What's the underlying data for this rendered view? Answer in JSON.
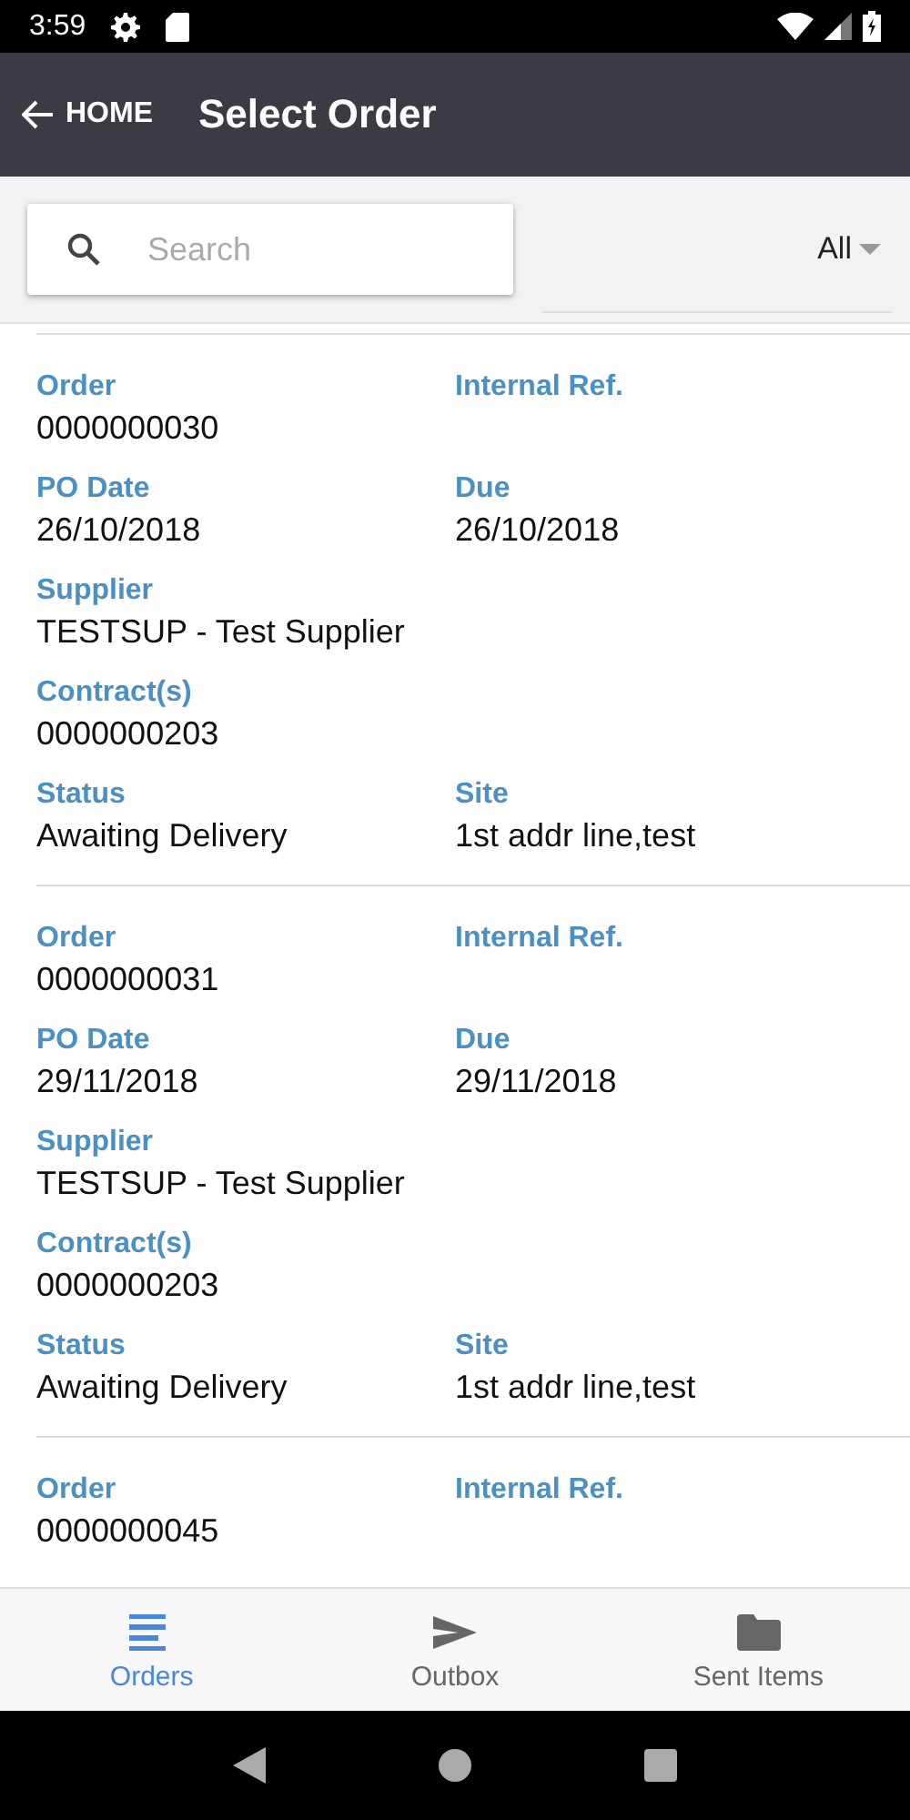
{
  "status_bar": {
    "time": "3:59"
  },
  "app_bar": {
    "back_label": "HOME",
    "title": "Select Order"
  },
  "search": {
    "placeholder": "Search"
  },
  "filter": {
    "value": "All"
  },
  "orders": [
    {
      "rows": [
        [
          {
            "label": "Order",
            "value": "0000000030"
          },
          {
            "label": "Internal Ref."
          }
        ],
        [
          {
            "label": "PO Date",
            "value": "26/10/2018"
          },
          {
            "label": "Due",
            "value": "26/10/2018"
          }
        ],
        [
          {
            "label": "Supplier",
            "value": "TESTSUP - Test Supplier"
          }
        ],
        [
          {
            "label": "Contract(s)",
            "value": "0000000203"
          }
        ],
        [
          {
            "label": "Status",
            "value": "Awaiting Delivery"
          },
          {
            "label": "Site",
            "value": "1st addr line,test"
          }
        ]
      ]
    },
    {
      "rows": [
        [
          {
            "label": "Order",
            "value": "0000000031"
          },
          {
            "label": "Internal Ref."
          }
        ],
        [
          {
            "label": "PO Date",
            "value": "29/11/2018"
          },
          {
            "label": "Due",
            "value": "29/11/2018"
          }
        ],
        [
          {
            "label": "Supplier",
            "value": "TESTSUP - Test Supplier"
          }
        ],
        [
          {
            "label": "Contract(s)",
            "value": "0000000203"
          }
        ],
        [
          {
            "label": "Status",
            "value": "Awaiting Delivery"
          },
          {
            "label": "Site",
            "value": "1st addr line,test"
          }
        ]
      ]
    },
    {
      "rows": [
        [
          {
            "label": "Order",
            "value": "0000000045"
          },
          {
            "label": "Internal Ref."
          }
        ]
      ]
    }
  ],
  "bottom_nav": [
    {
      "label": "Orders",
      "kind": "list",
      "selected": true
    },
    {
      "label": "Outbox",
      "kind": "send",
      "selected": false
    },
    {
      "label": "Sent Items",
      "kind": "folder",
      "selected": false
    }
  ]
}
